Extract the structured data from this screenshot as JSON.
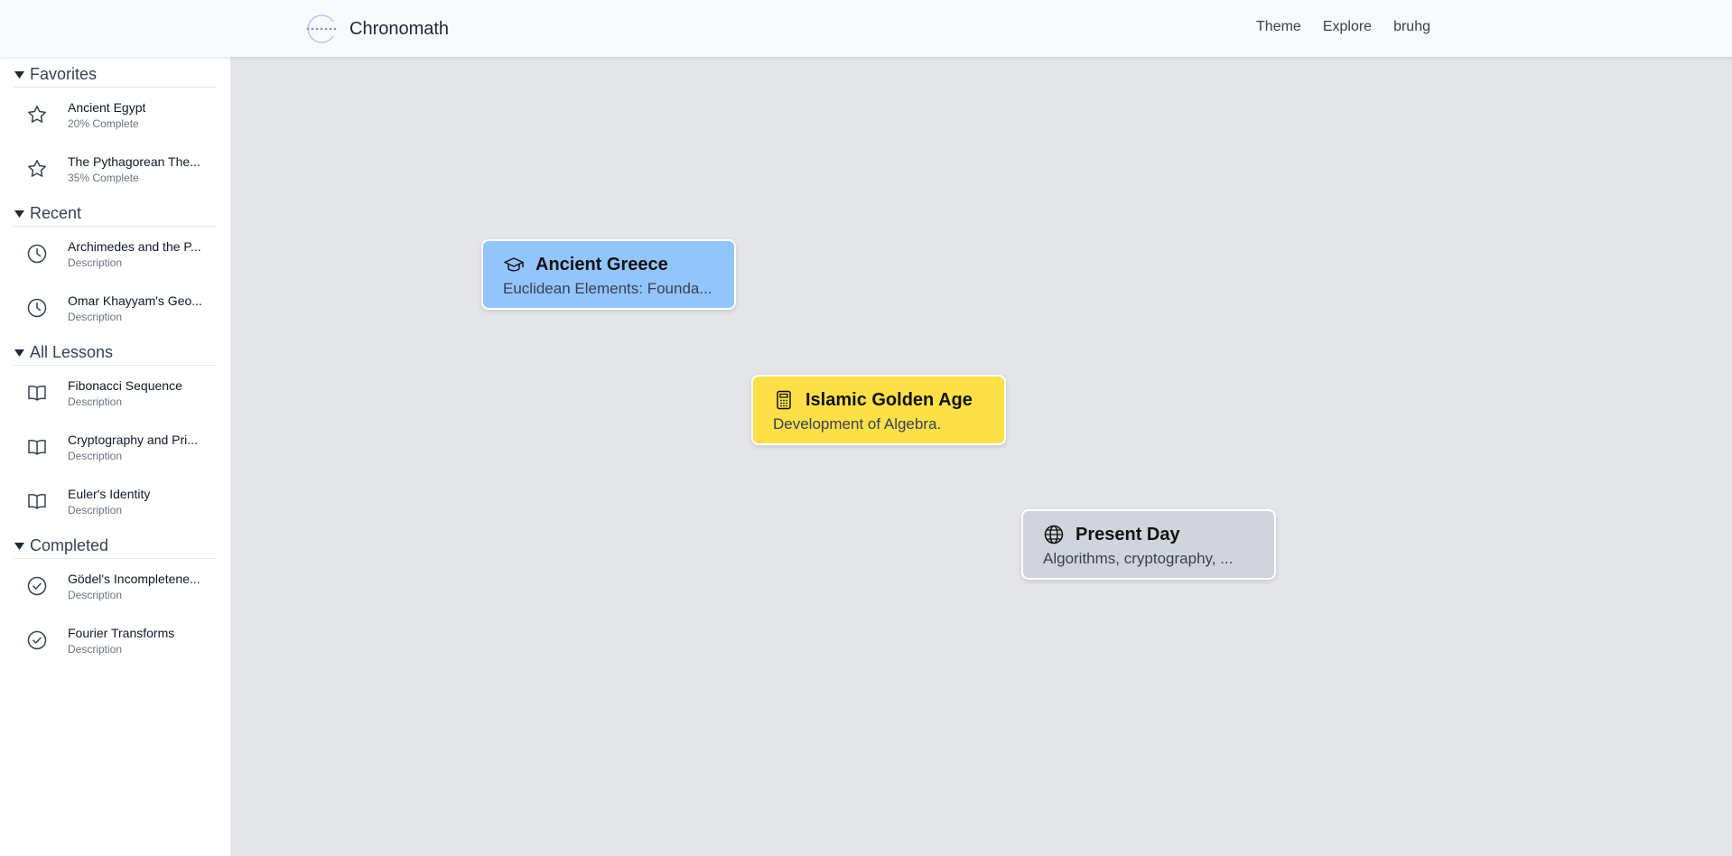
{
  "header": {
    "app_name": "Chronomath",
    "logo_icon": "chronomath-logo-icon",
    "nav": [
      {
        "label": "Theme"
      },
      {
        "label": "Explore"
      },
      {
        "label": "bruhg"
      }
    ]
  },
  "sidebar": {
    "sections": [
      {
        "title": "Favorites",
        "items": [
          {
            "title": "Ancient Egypt",
            "subtitle": "20% Complete",
            "icon": "star-icon"
          },
          {
            "title": "The Pythagorean The...",
            "subtitle": "35% Complete",
            "icon": "star-icon"
          }
        ]
      },
      {
        "title": "Recent",
        "items": [
          {
            "title": "Archimedes and the P...",
            "subtitle": "Description",
            "icon": "clock-icon"
          },
          {
            "title": "Omar Khayyam's Geo...",
            "subtitle": "Description",
            "icon": "clock-icon"
          }
        ]
      },
      {
        "title": "All Lessons",
        "items": [
          {
            "title": "Fibonacci Sequence",
            "subtitle": "Description",
            "icon": "book-icon"
          },
          {
            "title": "Cryptography and Pri...",
            "subtitle": "Description",
            "icon": "book-icon"
          },
          {
            "title": "Euler's Identity",
            "subtitle": "Description",
            "icon": "book-icon"
          }
        ]
      },
      {
        "title": "Completed",
        "items": [
          {
            "title": "Gödel's Incompletene...",
            "subtitle": "Description",
            "icon": "check-circle-icon"
          },
          {
            "title": "Fourier Transforms",
            "subtitle": "Description",
            "icon": "check-circle-icon"
          }
        ]
      }
    ]
  },
  "timeline": {
    "cards": [
      {
        "title": "Ancient Greece",
        "description": "Euclidean Elements: Founda...",
        "icon": "graduation-cap-icon",
        "color": "#93c5fd"
      },
      {
        "title": "Islamic Golden Age",
        "description": "Development of Algebra.",
        "icon": "calculator-icon",
        "color": "#fde047"
      },
      {
        "title": "Present Day",
        "description": "Algorithms, cryptography, ...",
        "icon": "globe-icon",
        "color": "#d1d5db"
      }
    ]
  },
  "colors": {
    "canvas_bg": "#e4e5e9",
    "header_bg": "#f8f9fb",
    "sidebar_bg": "#ffffff"
  }
}
